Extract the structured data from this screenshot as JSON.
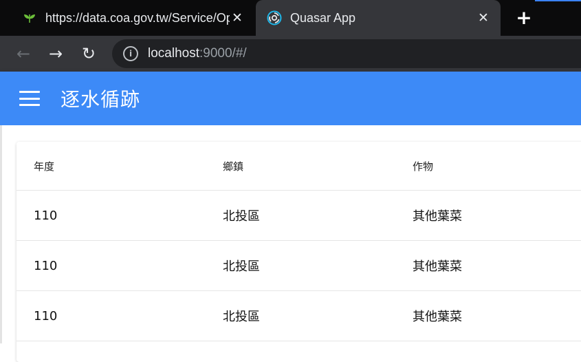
{
  "browser": {
    "tabs": [
      {
        "title": "https://data.coa.gov.tw/Service/OpenData/...",
        "favicon": "leaf-icon",
        "active": false
      },
      {
        "title": "Quasar App",
        "favicon": "quasar-icon",
        "active": true
      }
    ],
    "new_tab_icon": "+",
    "url_host": "localhost",
    "url_rest": ":9000/#/"
  },
  "app": {
    "title": "逐水循跡",
    "header_color": "#3d8af7"
  },
  "table": {
    "columns": [
      "年度",
      "鄉鎮",
      "作物"
    ],
    "rows": [
      [
        "110",
        "北投區",
        "其他葉菜"
      ],
      [
        "110",
        "北投區",
        "其他葉菜"
      ],
      [
        "110",
        "北投區",
        "其他葉菜"
      ]
    ]
  }
}
